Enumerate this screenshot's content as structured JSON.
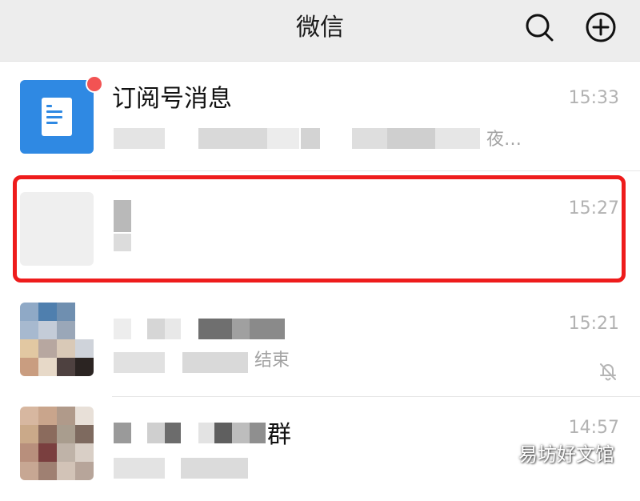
{
  "header": {
    "title": "微信",
    "search_icon": "search-icon",
    "add_icon": "plus-circle-icon"
  },
  "chats": [
    {
      "name": "订阅号消息",
      "time": "15:33",
      "preview_tail": "夜…",
      "avatar_icon": "document-icon",
      "unread_dot": true,
      "avatar_color": "#2f89e3"
    },
    {
      "time": "15:27",
      "highlighted": true
    },
    {
      "time": "15:21",
      "preview_tail": "结束",
      "muted": true
    },
    {
      "time": "14:57",
      "name_tail": "群"
    }
  ],
  "watermark": "易坊好文馆",
  "colors": {
    "header_bg": "#ededed",
    "highlight": "#ee1c1c",
    "unread": "#f25353",
    "time_text": "#b2b2b2"
  }
}
